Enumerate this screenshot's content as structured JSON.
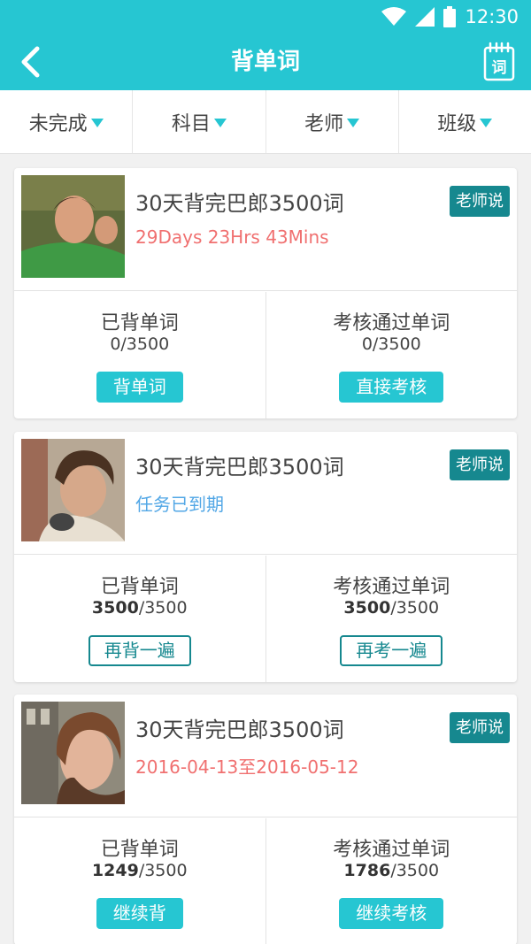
{
  "status_bar": {
    "time": "12:30"
  },
  "app_bar": {
    "title": "背单词",
    "vocab_icon_char": "词"
  },
  "filters": [
    {
      "label": "未完成"
    },
    {
      "label": "科目"
    },
    {
      "label": "老师"
    },
    {
      "label": "班级"
    }
  ],
  "colors": {
    "accent": "#26c6d2",
    "badge": "#16888f",
    "countdown": "#f07070",
    "expired": "#52a7e6"
  },
  "cards": [
    {
      "title": "30天背完巴郎3500词",
      "subtitle": "29Days 23Hrs 43Mins",
      "badge": "老师说",
      "memorized_label": "已背单词",
      "memorized_done": "0",
      "memorized_total": "/3500",
      "passed_label": "考核通过单词",
      "passed_done": "0",
      "passed_total": "/3500",
      "left_button": "背单词",
      "right_button": "直接考核"
    },
    {
      "title": "30天背完巴郎3500词",
      "subtitle": "任务已到期",
      "badge": "老师说",
      "memorized_label": "已背单词",
      "memorized_done": "3500",
      "memorized_total": "/3500",
      "passed_label": "考核通过单词",
      "passed_done": "3500",
      "passed_total": "/3500",
      "left_button": "再背一遍",
      "right_button": "再考一遍"
    },
    {
      "title": "30天背完巴郎3500词",
      "subtitle": "2016-04-13至2016-05-12",
      "badge": "老师说",
      "memorized_label": "已背单词",
      "memorized_done": "1249",
      "memorized_total": "/3500",
      "passed_label": "考核通过单词",
      "passed_done": "1786",
      "passed_total": "/3500",
      "left_button": "继续背",
      "right_button": "继续考核"
    }
  ]
}
